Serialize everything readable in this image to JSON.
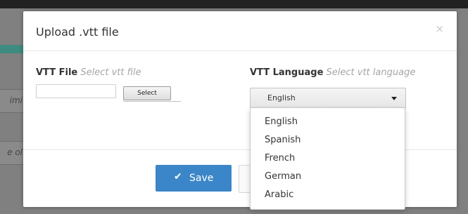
{
  "modal": {
    "title": "Upload .vtt file",
    "close_symbol": "×",
    "vtt_file": {
      "label": "VTT File",
      "hint": "Select vtt file",
      "value": "",
      "select_button": "Select"
    },
    "vtt_language": {
      "label": "VTT Language",
      "hint": "Select vtt language",
      "selected": "English"
    },
    "save_button": {
      "icon": "check-icon",
      "label": "Save"
    }
  },
  "dropdown": {
    "options": [
      "English",
      "Spanish",
      "French",
      "German",
      "Arabic"
    ]
  },
  "background": {
    "fragment_1": "imi",
    "fragment_2": "e ol"
  },
  "colors": {
    "primary": "#3b86c8",
    "teal": "#3e8b81",
    "overlay": "#808080",
    "topbar": "#222222"
  }
}
